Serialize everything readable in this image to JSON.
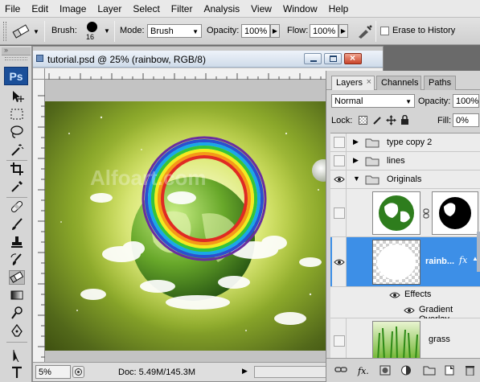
{
  "menubar": {
    "items": [
      "File",
      "Edit",
      "Image",
      "Layer",
      "Select",
      "Filter",
      "Analysis",
      "View",
      "Window",
      "Help"
    ]
  },
  "options": {
    "brush_label": "Brush:",
    "brush_size": "16",
    "mode_label": "Mode:",
    "mode_value": "Brush",
    "opacity_label": "Opacity:",
    "opacity_value": "100%",
    "flow_label": "Flow:",
    "flow_value": "100%",
    "erase_history_label": "Erase to History"
  },
  "document": {
    "title": "tutorial.psd @ 25% (rainbow, RGB/8)",
    "watermark": "Alfoart.com",
    "status_zoom": "5%",
    "status_doc": "Doc: 5.49M/145.3M"
  },
  "layers_panel": {
    "tabs": [
      "Layers",
      "Channels",
      "Paths"
    ],
    "blend_mode": "Normal",
    "opacity_label": "Opacity:",
    "opacity_value": "100%",
    "lock_label": "Lock:",
    "fill_label": "Fill:",
    "fill_value": "0%",
    "layers": [
      {
        "name": "type copy 2",
        "kind": "group",
        "visible": false
      },
      {
        "name": "lines",
        "kind": "group",
        "visible": false
      },
      {
        "name": "Originals",
        "kind": "group",
        "visible": true,
        "expanded": true
      },
      {
        "name": "",
        "kind": "layer-mask",
        "visible": false
      },
      {
        "name": "rainb...",
        "kind": "layer",
        "visible": true,
        "selected": true,
        "fx": "fx"
      },
      {
        "name": "Effects",
        "kind": "effect-header",
        "visible": true
      },
      {
        "name": "Gradient Overlay",
        "kind": "effect",
        "visible": true
      },
      {
        "name": "grass",
        "kind": "layer",
        "visible": false
      }
    ]
  },
  "colors": {
    "accent": "#3d8fe7",
    "ps_logo": "#1b4f99",
    "menubar": "#e9e9e9"
  }
}
